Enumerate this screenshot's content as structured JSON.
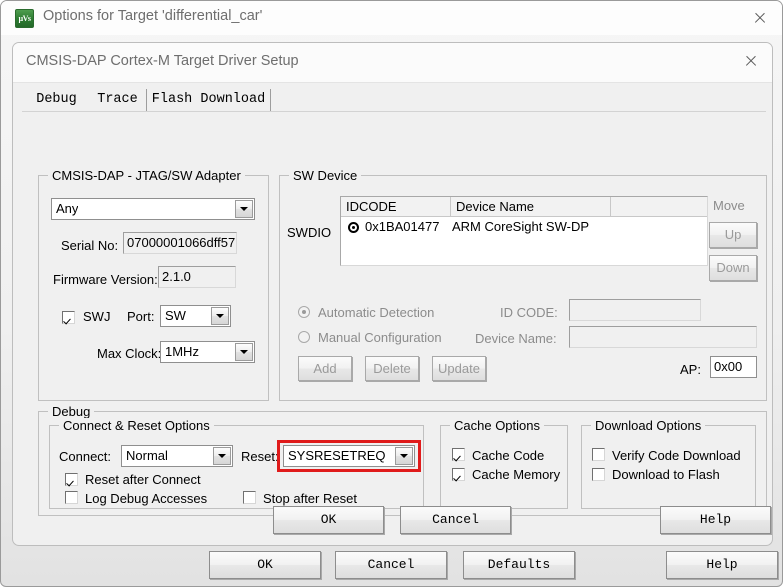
{
  "outer_window": {
    "title": "Options for Target 'differential_car'",
    "icon": "uvision-logo-icon",
    "icon_text": "µVs",
    "close_icon": "close-icon"
  },
  "inner_dialog": {
    "title": "CMSIS-DAP Cortex-M Target Driver Setup",
    "close_icon": "close-icon"
  },
  "tabs": [
    {
      "label": "Debug",
      "active": true
    },
    {
      "label": "Trace",
      "active": false
    },
    {
      "label": "Flash Download",
      "active": false
    }
  ],
  "adapter_group": {
    "title": "CMSIS-DAP - JTAG/SW Adapter",
    "adapter_combo_value": "Any",
    "serial_no_label": "Serial No:",
    "serial_no_value": "07000001066dff57",
    "firmware_label": "Firmware Version:",
    "firmware_value": "2.1.0",
    "swj_label": "SWJ",
    "swj_checked": true,
    "port_label": "Port:",
    "port_value": "SW",
    "max_clock_label": "Max Clock:",
    "max_clock_value": "1MHz"
  },
  "sw_device_group": {
    "title": "SW Device",
    "swdio_label": "SWDIO",
    "columns": [
      "IDCODE",
      "Device Name",
      ""
    ],
    "rows": [
      {
        "idcode": "0x1BA01477",
        "device_name": "ARM CoreSight SW-DP",
        "selected": true
      }
    ],
    "move_label": "Move",
    "up_label": "Up",
    "down_label": "Down",
    "automatic_detection_label": "Automatic Detection",
    "automatic_detection_selected": true,
    "manual_configuration_label": "Manual Configuration",
    "manual_configuration_selected": false,
    "id_code_label": "ID CODE:",
    "id_code_value": "",
    "device_name_label": "Device Name:",
    "device_name_value": "",
    "add_label": "Add",
    "delete_label": "Delete",
    "update_label": "Update",
    "ap_label": "AP:",
    "ap_value": "0x00"
  },
  "debug_group": {
    "title": "Debug",
    "connect_reset_group": {
      "title": "Connect & Reset Options",
      "connect_label": "Connect:",
      "connect_value": "Normal",
      "reset_label": "Reset:",
      "reset_value": "SYSRESETREQ",
      "reset_highlight_color": "#e01b1b",
      "reset_after_connect_label": "Reset after Connect",
      "reset_after_connect_checked": true,
      "log_debug_accesses_label": "Log Debug Accesses",
      "log_debug_accesses_checked": false,
      "stop_after_reset_label": "Stop after Reset",
      "stop_after_reset_checked": false
    },
    "cache_group": {
      "title": "Cache Options",
      "cache_code_label": "Cache Code",
      "cache_code_checked": true,
      "cache_memory_label": "Cache Memory",
      "cache_memory_checked": true
    },
    "download_group": {
      "title": "Download Options",
      "verify_code_download_label": "Verify Code Download",
      "verify_code_download_checked": false,
      "download_to_flash_label": "Download to Flash",
      "download_to_flash_checked": false
    }
  },
  "inner_buttons": {
    "ok": "OK",
    "cancel": "Cancel",
    "help": "Help"
  },
  "outer_buttons": {
    "ok": "OK",
    "cancel": "Cancel",
    "defaults": "Defaults",
    "help": "Help"
  }
}
